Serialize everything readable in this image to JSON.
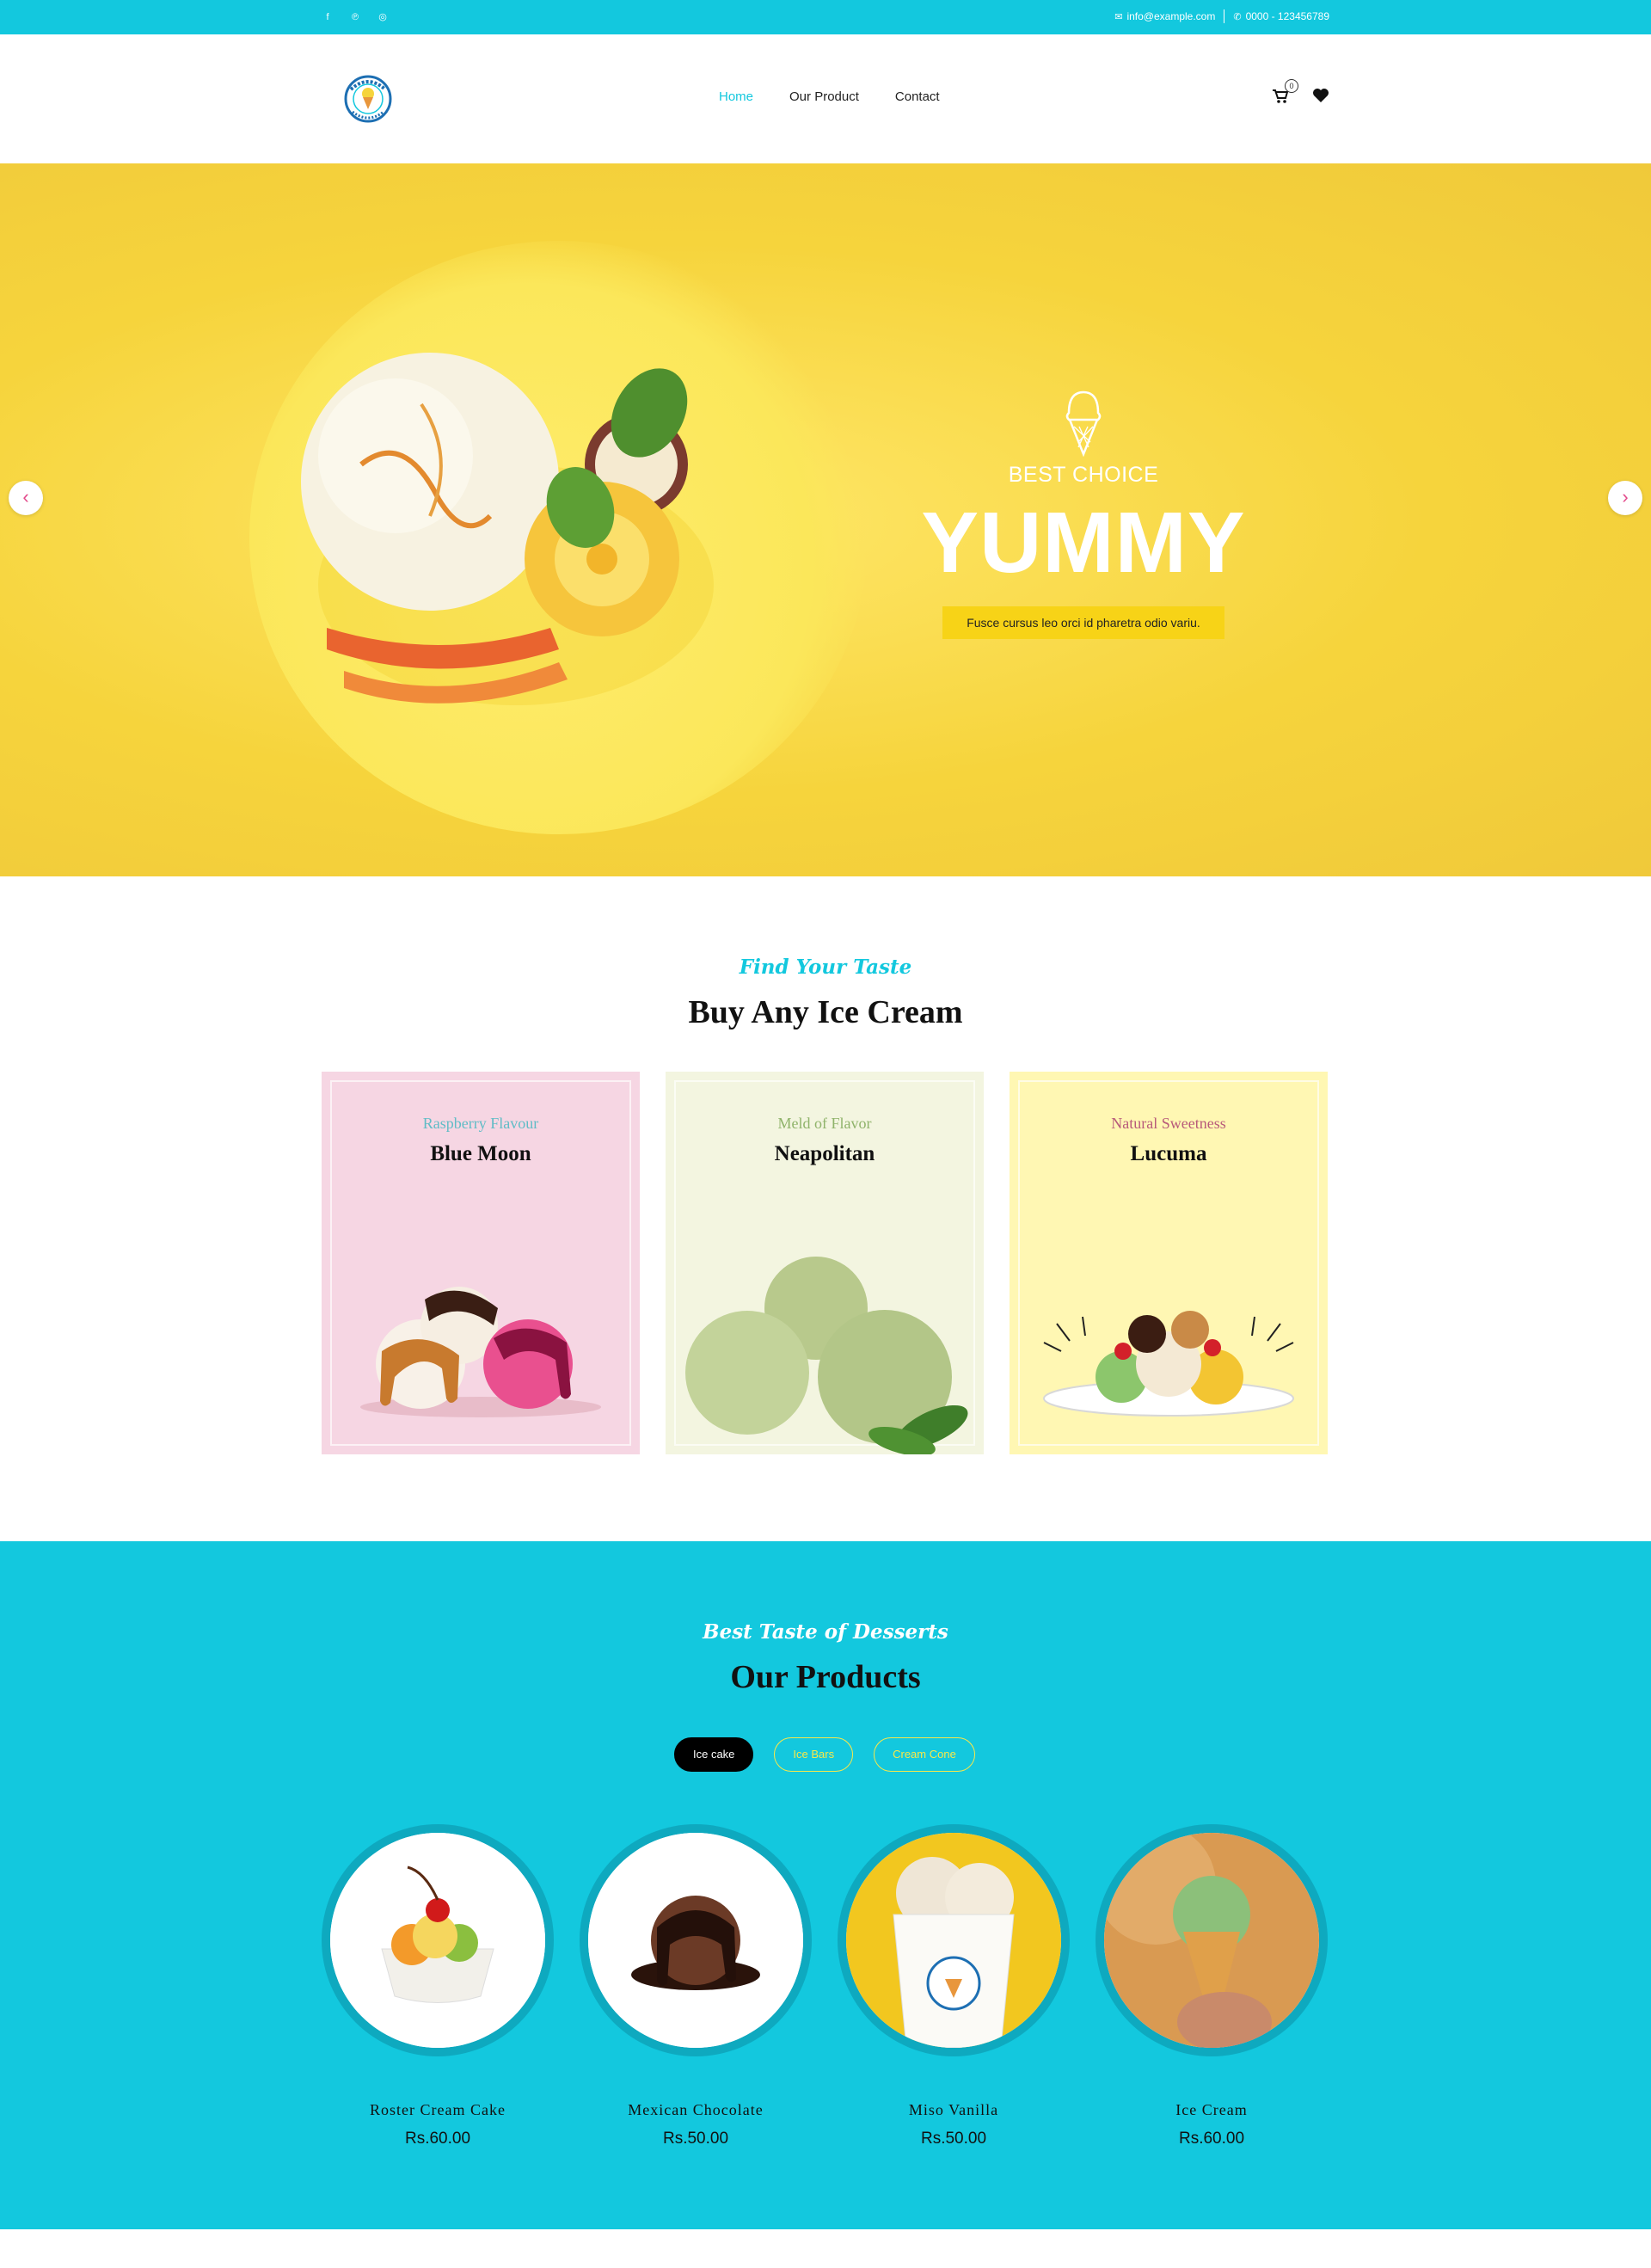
{
  "topbar": {
    "social_icons": [
      "facebook-icon",
      "pinterest-icon",
      "instagram-icon"
    ],
    "email": "info@example.com",
    "phone": "0000 - 123456789"
  },
  "header": {
    "logo_text": "SUNNY UPSIDE CREAMERY",
    "nav": [
      {
        "label": "Home",
        "active": true
      },
      {
        "label": "Our Product",
        "active": false
      },
      {
        "label": "Contact",
        "active": false
      }
    ],
    "cart_count": "0"
  },
  "hero": {
    "subtitle": "BEST CHOICE",
    "title": "YUMMY",
    "tagline": "Fusce cursus leo orci id pharetra odio variu.",
    "prev_arrow": "‹",
    "next_arrow": "›"
  },
  "categories": {
    "script": "Find Your Taste",
    "title": "Buy Any Ice Cream",
    "cards": [
      {
        "tagline": "Raspberry Flavour",
        "name": "Blue Moon",
        "bg": "#f6d6e3",
        "tag_color": "#5fbcc6"
      },
      {
        "tagline": "Meld of Flavor",
        "name": "Neapolitan",
        "bg": "#f3f5e0",
        "tag_color": "#8fb36a"
      },
      {
        "tagline": "Natural Sweetness",
        "name": "Lucuma",
        "bg": "#fff7b3",
        "tag_color": "#b85a7a"
      }
    ]
  },
  "products": {
    "script": "Best Taste of Desserts",
    "title": "Our Products",
    "tabs": [
      {
        "label": "Ice cake",
        "active": true
      },
      {
        "label": "Ice Bars",
        "active": false
      },
      {
        "label": "Cream Cone",
        "active": false
      }
    ],
    "items": [
      {
        "name": "Roster Cream Cake",
        "price": "Rs.60.00"
      },
      {
        "name": "Mexican Chocolate",
        "price": "Rs.50.00"
      },
      {
        "name": "Miso Vanilla",
        "price": "Rs.50.00"
      },
      {
        "name": "Ice Cream",
        "price": "Rs.60.00"
      }
    ]
  },
  "colors": {
    "accent": "#13c8de",
    "hero_yellow": "#f6d43c",
    "tag_yellow": "#f7d317"
  }
}
